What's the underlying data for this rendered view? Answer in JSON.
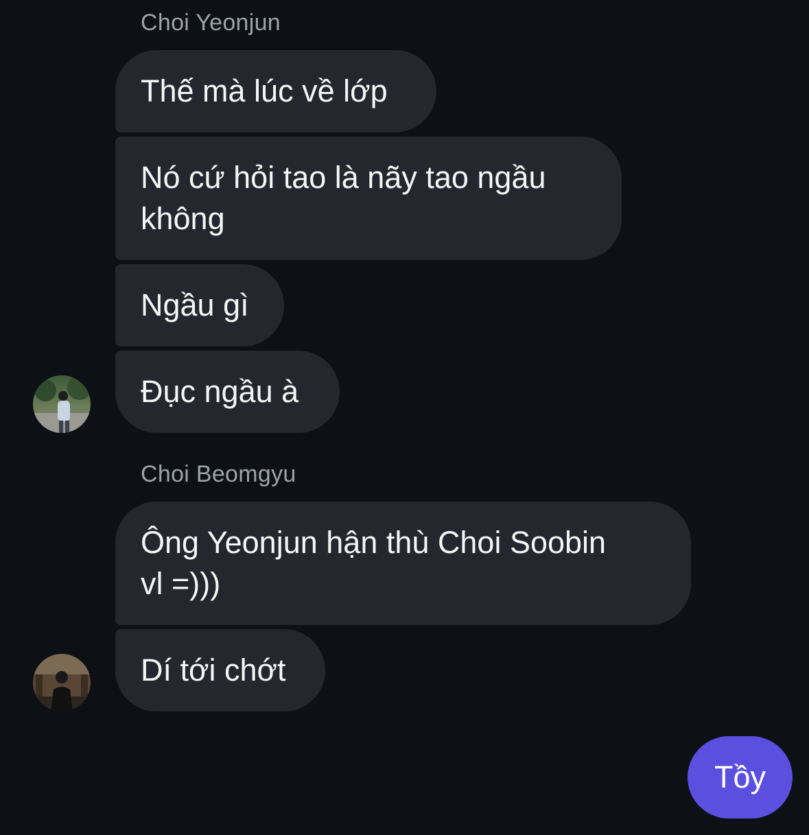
{
  "colors": {
    "background": "#0d1015",
    "incoming_bubble": "#24272d",
    "outgoing_bubble": "#5b4fe0",
    "sender_name": "#9ea3ab"
  },
  "groups": [
    {
      "sender": "Choi Yeonjun",
      "messages": [
        "Thế mà lúc về lớp",
        "Nó cứ hỏi tao là nãy tao ngầu\nkhông",
        "Ngầu gì",
        "Đục ngầu à"
      ]
    },
    {
      "sender": "Choi Beomgyu",
      "messages": [
        "Ông Yeonjun hận thù Choi Soobin\nvl =)))",
        "Dí tới chớt"
      ]
    }
  ],
  "outgoing": {
    "messages": [
      "Tồy"
    ]
  }
}
